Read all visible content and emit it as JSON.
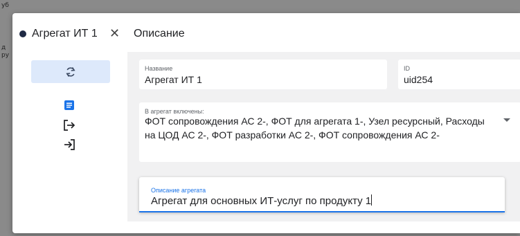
{
  "background": {
    "fragments": [
      "уб",
      "д",
      "ру"
    ]
  },
  "dialog": {
    "tab": {
      "title": "Агрегат ИТ 1",
      "close_glyph": "✕"
    },
    "section_title": "Описание",
    "sidebar": {
      "icons": [
        "refresh-icon",
        "document-icon",
        "export-icon",
        "import-icon"
      ]
    },
    "fields": {
      "name": {
        "label": "Название",
        "value": "Агрегат ИТ 1"
      },
      "id": {
        "label": "ID",
        "value": "uid254"
      },
      "included": {
        "label": "В агрегат включены:",
        "value": "ФОТ сопровождения АС 2-, ФОТ для агрегата 1-, Узел ресурсный, Расходы на ЦОД АС 2-, ФОТ разработки АС 2-, ФОТ сопровождения АС 2-"
      },
      "description": {
        "label": "Описание агрегата",
        "value": "Агрегат для основных ИТ-услуг по продукту 1"
      }
    }
  },
  "colors": {
    "accent": "#1a73e8",
    "refresh_bg": "#dde9fb",
    "content_bg": "#f1f1f2",
    "dot": "#1f2a44"
  }
}
